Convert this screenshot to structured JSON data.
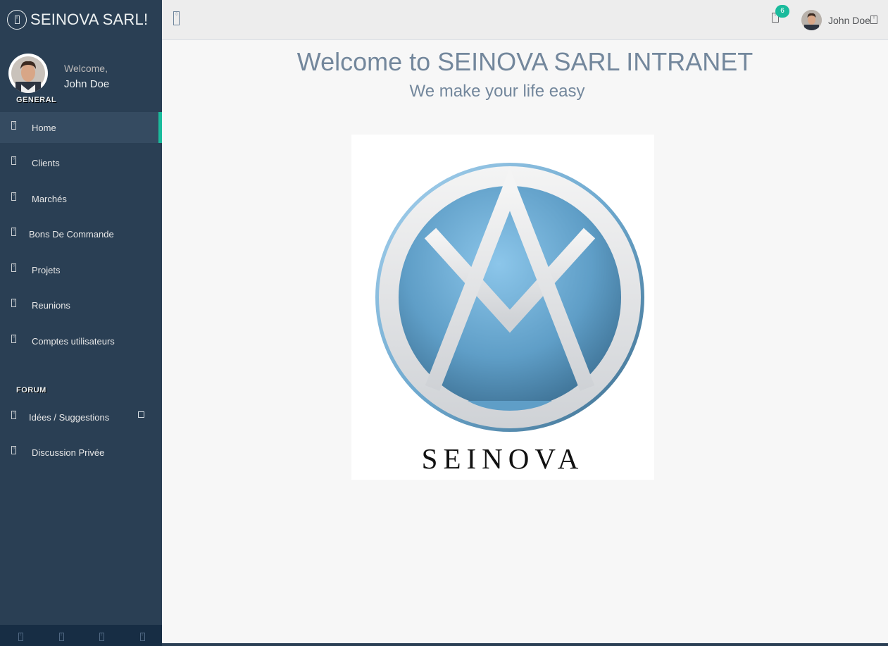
{
  "brand": {
    "title": "SEINOVA SARL!",
    "icon": "paw-icon"
  },
  "profile": {
    "welcome": "Welcome,",
    "name": "John Doe"
  },
  "sidebar": {
    "general_title": "GENERAL",
    "forum_title": "FORUM",
    "items": [
      {
        "label": "Home",
        "icon": "home-icon",
        "active": true
      },
      {
        "label": "Clients",
        "icon": "users-icon"
      },
      {
        "label": "Marchés",
        "icon": "briefcase-icon"
      },
      {
        "label": "Bons De Commande",
        "icon": "file-icon"
      },
      {
        "label": "Projets",
        "icon": "folder-icon"
      },
      {
        "label": "Reunions",
        "icon": "calendar-icon"
      },
      {
        "label": "Comptes utilisateurs",
        "icon": "user-icon"
      }
    ],
    "forum_items": [
      {
        "label": "Idées / Suggestions",
        "icon": "lightbulb-icon"
      },
      {
        "label": "Discussion Privée",
        "icon": "comments-icon"
      }
    ]
  },
  "topnav": {
    "notification_count": "6",
    "user_name": "John Doe"
  },
  "main": {
    "title": "Welcome to SEINOVA SARL INTRANET",
    "subtitle": "We make your life easy",
    "logo_text": "SEINOVA"
  },
  "colors": {
    "sidebar_bg": "#2a3f54",
    "accent": "#1abb9c",
    "title_text": "#73879c"
  }
}
